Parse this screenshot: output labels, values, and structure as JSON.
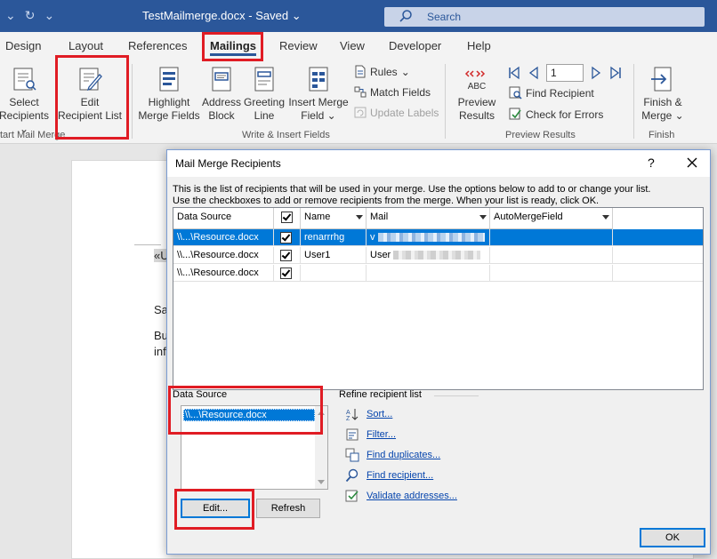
{
  "window": {
    "doc_title": "TestMailmerge.docx",
    "saved_status": "Saved",
    "search_placeholder": "Search"
  },
  "tabs": [
    {
      "label": "Design"
    },
    {
      "label": "Layout"
    },
    {
      "label": "References"
    },
    {
      "label": "Mailings"
    },
    {
      "label": "Review"
    },
    {
      "label": "View"
    },
    {
      "label": "Developer"
    },
    {
      "label": "Help"
    }
  ],
  "ribbon": {
    "start_mail_merge": {
      "select_recipients": [
        "Select",
        "Recipients"
      ],
      "edit_recipient_list": [
        "Edit",
        "Recipient List"
      ],
      "group_label": "tart Mail Merge"
    },
    "write_insert": {
      "highlight": [
        "Highlight",
        "Merge Fields"
      ],
      "address": [
        "Address",
        "Block"
      ],
      "greeting": [
        "Greeting",
        "Line"
      ],
      "insert_merge": [
        "Insert Merge",
        "Field"
      ],
      "rules": "Rules",
      "match_fields": "Match Fields",
      "update_labels": "Update Labels",
      "group_label": "Write & Insert Fields"
    },
    "preview": {
      "preview_results": [
        "Preview",
        "Results"
      ],
      "abc": "ABC",
      "record": "1",
      "find_recipient": "Find Recipient",
      "check_errors": "Check for Errors",
      "group_label": "Preview Results"
    },
    "finish": {
      "finish_merge": [
        "Finish &",
        "Merge"
      ],
      "group_label": "Finish"
    }
  },
  "document": {
    "field_fragment": "«U",
    "line1": "Sa",
    "line2": "Bu",
    "line3": "inf"
  },
  "dialog": {
    "title": "Mail Merge Recipients",
    "help": "?",
    "info_line1": "This is the list of recipients that will be used in your merge.  Use the options below to add to or change your list.",
    "info_line2": "Use the checkboxes to add or remove recipients from the merge.  When your list is ready, click OK.",
    "columns": [
      "Data Source",
      "",
      "Name",
      "Mail",
      "AutoMergeField"
    ],
    "rows": [
      {
        "source": "\\\\...\\Resource.docx",
        "checked": true,
        "name": "renarrrhg",
        "mail": "v",
        "selected": true
      },
      {
        "source": "\\\\...\\Resource.docx",
        "checked": true,
        "name": "User1",
        "mail": "User",
        "selected": false
      },
      {
        "source": "\\\\...\\Resource.docx",
        "checked": true,
        "name": "",
        "mail": "",
        "selected": false
      }
    ],
    "data_source_label": "Data Source",
    "data_source_item": "\\\\...\\Resource.docx",
    "edit_button": "Edit...",
    "refresh_button": "Refresh",
    "refine_label": "Refine recipient list",
    "refine_links": [
      "Sort...",
      "Filter...",
      "Find duplicates...",
      "Find recipient...",
      "Validate addresses..."
    ],
    "ok_button": "OK"
  },
  "colors": {
    "word_blue": "#2b579a",
    "selection": "#0078d7",
    "highlight_red": "#e01c24"
  }
}
